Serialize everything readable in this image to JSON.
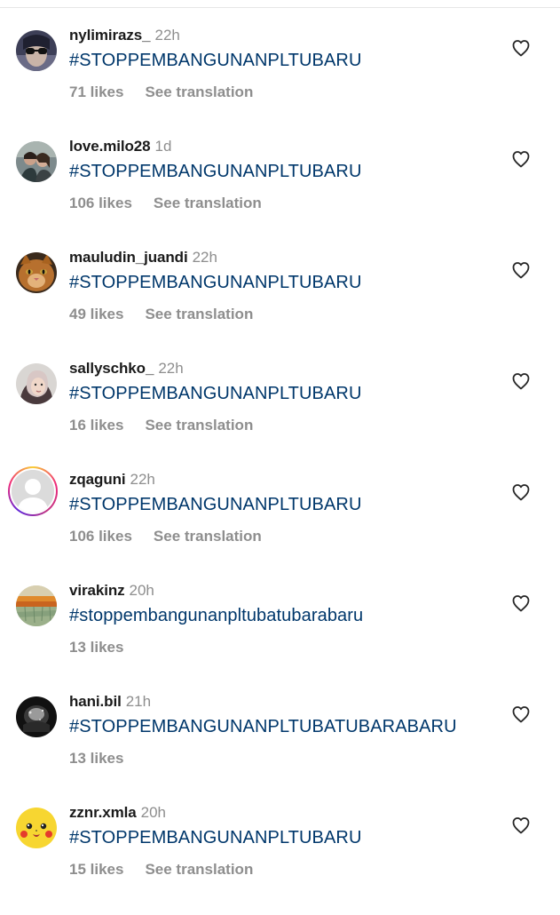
{
  "comments": [
    {
      "username": "nylimirazs_",
      "time": "22h",
      "text": "#STOPPEMBANGUNANPLTUBARU",
      "likes": "71 likes",
      "translate": "See translation",
      "avatar": "avatar-photo-person-sunglasses"
    },
    {
      "username": "love.milo28",
      "time": "1d",
      "text": "#STOPPEMBANGUNANPLTUBARU",
      "likes": "106 likes",
      "translate": "See translation",
      "avatar": "avatar-photo-couple"
    },
    {
      "username": "mauludin_juandi",
      "time": "22h",
      "text": "#STOPPEMBANGUNANPLTUBARU",
      "likes": "49 likes",
      "translate": "See translation",
      "avatar": "avatar-photo-cat"
    },
    {
      "username": "sallyschko_",
      "time": "22h",
      "text": "#STOPPEMBANGUNANPLTUBARU",
      "likes": "16 likes",
      "translate": "See translation",
      "avatar": "avatar-photo-woman-hijab"
    },
    {
      "username": "zqaguni",
      "time": "22h",
      "text": "#STOPPEMBANGUNANPLTUBARU",
      "likes": "106 likes",
      "translate": "See translation",
      "avatar": "avatar-default-with-story-ring"
    },
    {
      "username": "virakinz",
      "time": "20h",
      "text": "#stoppembangunanpltubatubarabaru",
      "likes": "13 likes",
      "translate": "",
      "avatar": "avatar-painting-field"
    },
    {
      "username": "hani.bil",
      "time": "21h",
      "text": "#STOPPEMBANGUNANPLTUBATUBARABARU",
      "likes": "13 likes",
      "translate": "",
      "avatar": "avatar-photo-dark"
    },
    {
      "username": "zznr.xmla",
      "time": "20h",
      "text": "#STOPPEMBANGUNANPLTUBARU",
      "likes": "15 likes",
      "translate": "See translation",
      "avatar": "avatar-pikachu"
    }
  ],
  "colors": {
    "hashtag": "#00376b",
    "secondary": "#8e8e8e",
    "username": "#1a1a1a",
    "icon": "#262626"
  },
  "icons": {
    "like": "heart-outline-icon"
  }
}
